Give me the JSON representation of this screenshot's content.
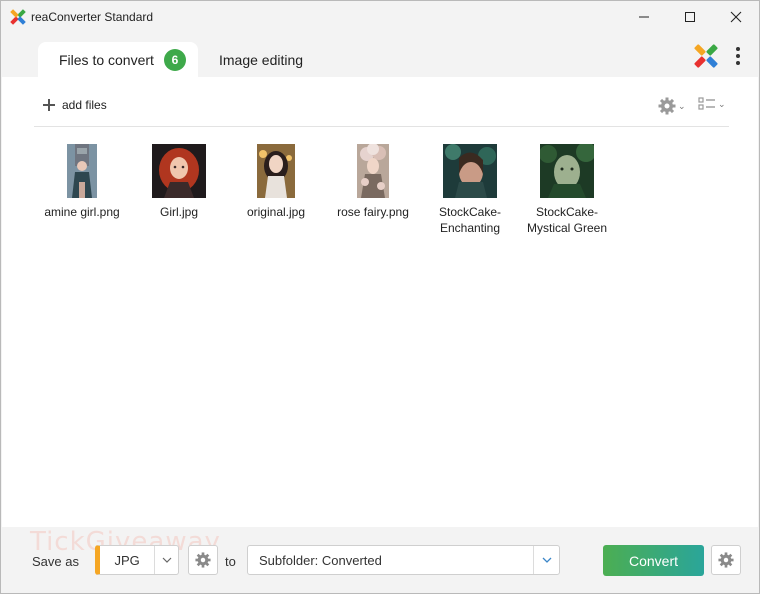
{
  "window": {
    "title": "reaConverter Standard"
  },
  "tabs": {
    "files_label": "Files to convert",
    "files_count": "6",
    "editing_label": "Image editing"
  },
  "toolbar": {
    "add_files_label": "add files"
  },
  "files": [
    {
      "name": "amine girl.png"
    },
    {
      "name": "Girl.jpg"
    },
    {
      "name": "original.jpg"
    },
    {
      "name": "rose fairy.png"
    },
    {
      "name_line1": "StockCake-",
      "name_line2": "Enchanting"
    },
    {
      "name_line1": "StockCake-",
      "name_line2": "Mystical Green"
    }
  ],
  "bottom": {
    "watermark_text": "TickGiveaway",
    "save_as_label": "Save as",
    "format_value": "JPG",
    "to_label": "to",
    "destination_value": "Subfolder: Converted",
    "convert_label": "Convert"
  },
  "colors": {
    "badge": "#3ea94a",
    "format_accent": "#f5a623",
    "convert_start": "#4cae52",
    "convert_end": "#2aa59a"
  },
  "icons": {
    "app": "reaconverter-logo-icon",
    "min": "minimize-icon",
    "max": "maximize-icon",
    "close": "close-icon",
    "menu": "kebab-menu-icon",
    "add": "plus-icon",
    "settings": "gear-icon",
    "view": "list-view-icon",
    "dropdown": "chevron-down-icon"
  }
}
